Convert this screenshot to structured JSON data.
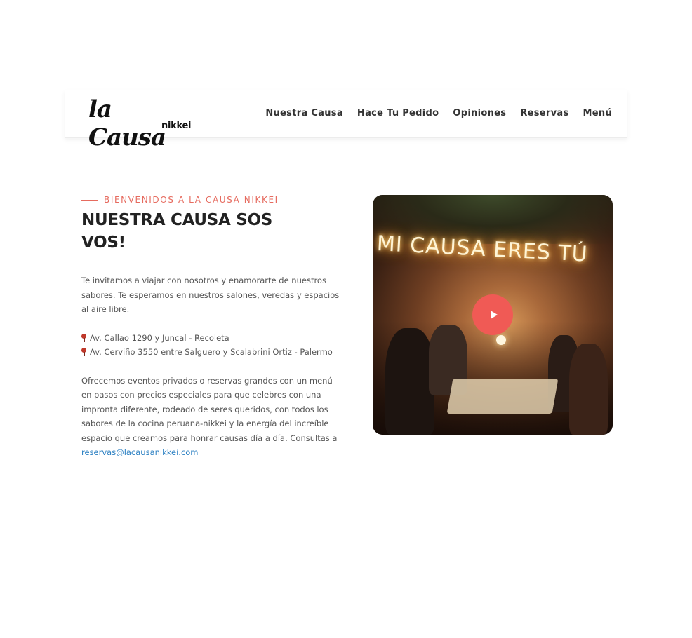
{
  "brand": {
    "logo_main": "la Causa",
    "logo_sub": "nikkei"
  },
  "nav": {
    "items": [
      {
        "label": "Nuestra Causa"
      },
      {
        "label": "Hace Tu Pedido"
      },
      {
        "label": "Opiniones"
      },
      {
        "label": "Reservas"
      },
      {
        "label": "Menú"
      }
    ]
  },
  "hero": {
    "eyebrow": "BIENVENIDOS A LA CAUSA NIKKEI",
    "title": "NUESTRA CAUSA SOS VOS!",
    "intro": "Te invitamos a viajar con nosotros y enamorarte de nuestros sabores. Te esperamos en nuestros salones, veredas y espacios al aire libre.",
    "addresses": [
      "Av. Callao 1290 y Juncal - Recoleta",
      "Av. Cerviño 3550 entre Salguero y Scalabrini Ortiz - Palermo"
    ],
    "events_text": "Ofrecemos eventos privados o reservas grandes con un menú en pasos con precios especiales para que celebres con una impronta diferente, rodeado de seres queridos, con todos los sabores de la cocina peruana-nikkei y la energía del increíble espacio que creamos para honrar causas día a día. Consultas a ",
    "email": "reservas@lacausanikkei.com"
  },
  "video": {
    "neon_text": "MI CAUSA ERES TÚ",
    "play_icon": "play-icon"
  },
  "colors": {
    "accent": "#e66b5f",
    "play": "#f05a55",
    "link": "#2a7fc2"
  }
}
